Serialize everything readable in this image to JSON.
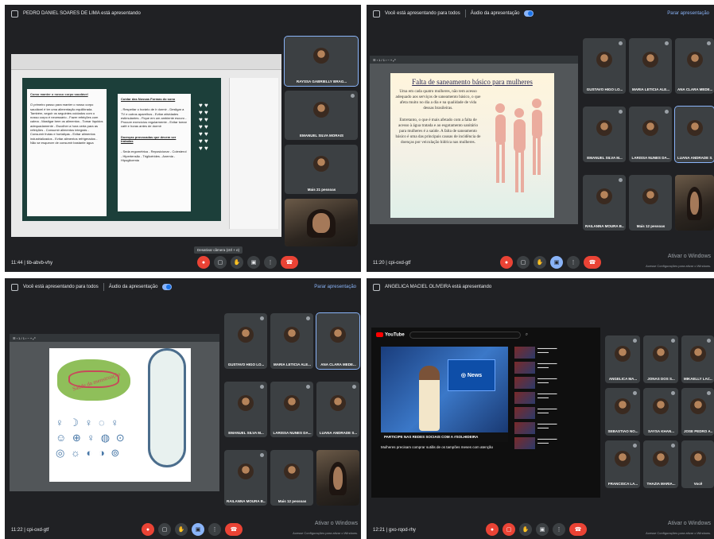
{
  "q1": {
    "presenter": "PEDRO DANIEL SOARES DE LIMA está apresentando",
    "meeting_code": "11:44 | tib-abvb-vhy",
    "tooltip": "Desativar câmera (ctrl + e)",
    "participants": [
      {
        "name": "RAYSSA GABRIELLY BRAG..."
      },
      {
        "name": "EMANUEL SILVA MORAIS"
      },
      {
        "name": "Mais 21 pessoas"
      }
    ],
    "doc": {
      "left_title": "Como manter o nosso corpo saudável",
      "left_text": "O primeiro passo para manter o nosso corpo saudável é ter uma alimentação equilibrada. Também, seguir os seguintes cuidados com o nosso corpo é necessário - Fazer refeições com calma - Mastigar bem os alimentos - Tomar líquidos adequadamente - Escolher a hora certa para as refeições - Consumir alimentos integrais - Consumir frutas e hortaliças - Evitar alimentos industrializados - Evitar alimentos refrigerados - Não se esquecer de consumir bastante água",
      "right_title": "Cuidar das Nossas Formas do sono",
      "right_text": "- Respeitar o horário de ir dormir - Desligar a TV e outros aparelhos - Evitar atividades estimulantes - Fique em um ambiente escuro - Procure exercícios regularmente - Evitar tomar café e horas antes de dormir",
      "right_title2": "Doenças provocadas que devem ser tratadas",
      "right_text2": "- Seda ergométrica - Reposicionar - Colesterol - Hipertensão - Triglicérides - Anemia - Hipoglicemia"
    }
  },
  "q2": {
    "presenting": "Você está apresentando para todos",
    "audio": "Áudio da apresentação",
    "stop": "Parar apresentação",
    "meeting_code": "11:20 | cpi-oxd-gtf",
    "windows_line1": "Ativar o Windows",
    "windows_line2": "Acesse Configurações para ativar o Windows.",
    "slide_title": "Falta de saneamento básico para mulheres",
    "slide_p1": "Uma em cada quatro mulheres, não tem acesso adequado aos serviços de saneamento básico, o que afeta muito no dia a dia e na qualidade de vida dessas brasileiras.",
    "slide_p2": "Entretanto, o que é mais afetado com a falta de acesso à água tratada e ao esgotamento sanitário para mulheres é a saúde. A falta de saneamento básico é uma das principais causas de incidência de doenças por veiculação hídrica nas mulheres.",
    "participants": [
      {
        "name": "GUSTAVO HIGO LO..."
      },
      {
        "name": "MARIA LETICIA ALE..."
      },
      {
        "name": "ANA CLARA MEDE..."
      },
      {
        "name": "EMANUEL SILVA M..."
      },
      {
        "name": "LARISSA NUNES DA..."
      },
      {
        "name": "LUANA ANDRADE S..."
      },
      {
        "name": "RAILANNA MOURA B..."
      },
      {
        "name": "Mais 12 pessoas"
      },
      {
        "name": ""
      }
    ]
  },
  "q3": {
    "presenting": "Você está apresentando para todos",
    "audio": "Áudio da apresentação",
    "stop": "Parar apresentação",
    "meeting_code": "11:22 | cpi-oxd-gtf",
    "windows_line1": "Ativar o Windows",
    "windows_line2": "Acesse Configurações para ativar o Windows.",
    "slide_label": "Saúde da menstruação",
    "participants": [
      {
        "name": "GUSTAVO HIGO LO..."
      },
      {
        "name": "MARIA LETICIA ALE..."
      },
      {
        "name": "ANA CLARA MEDE..."
      },
      {
        "name": "EMANUEL SILVA M..."
      },
      {
        "name": "LARISSA NUNES DA..."
      },
      {
        "name": "LUANA ANDRADE S..."
      },
      {
        "name": "RAILANNA MOURA B..."
      },
      {
        "name": "Mais 12 pessoas"
      },
      {
        "name": ""
      }
    ]
  },
  "q4": {
    "presenter": "ANGELICA MACIEL OLIVEIRA está apresentando",
    "meeting_code": "12:21 | gxo-rqod-rhy",
    "windows_line1": "Ativar o Windows",
    "windows_line2": "Acesse Configurações para ativar o Windows.",
    "yt_logo": "YouTube",
    "banner": "PARTICIPE NAS REDES SOCIAIS COM A #SOLHIDEIRA",
    "video_title": "Mulheres precisam comprar sutiãs de os tampões meses com atenção",
    "participants": [
      {
        "name": "ANGELICA MA..."
      },
      {
        "name": "JONAS DOS S..."
      },
      {
        "name": "MIKAELLY LAC..."
      },
      {
        "name": "SEBASTIAO NO..."
      },
      {
        "name": "SAYSA KHAN..."
      },
      {
        "name": "JOSE PEDRO A..."
      },
      {
        "name": "FRANCISCA LA..."
      },
      {
        "name": "THAZIA MARIA..."
      },
      {
        "name": "Você"
      }
    ]
  }
}
